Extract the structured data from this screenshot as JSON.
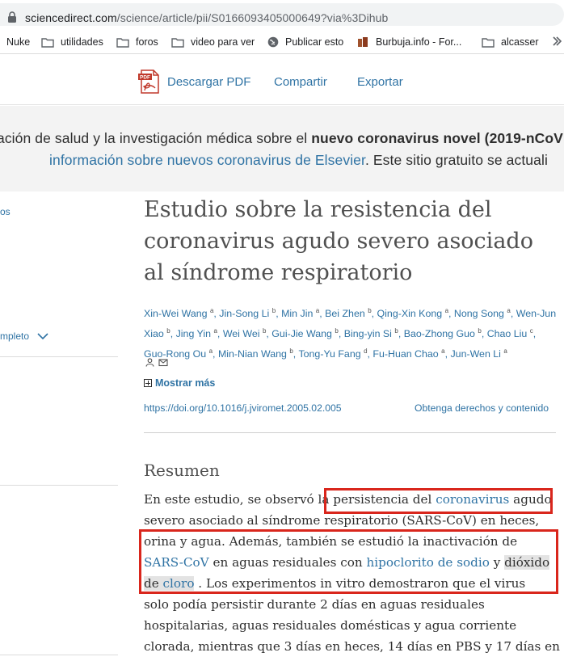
{
  "browser": {
    "url_host": "sciencedirect.com",
    "url_path": "/science/article/pii/S0166093405000649?via%3Dihub",
    "bookmarks": [
      {
        "label": "Nuke",
        "icon": "none"
      },
      {
        "label": "utilidades",
        "icon": "folder-icon"
      },
      {
        "label": "foros",
        "icon": "folder-icon"
      },
      {
        "label": "video para ver",
        "icon": "folder-icon"
      },
      {
        "label": "Publicar esto",
        "icon": "globe-icon"
      },
      {
        "label": "Burbuja.info - For...",
        "icon": "site-icon"
      },
      {
        "label": "alcasser",
        "icon": "folder-icon"
      }
    ]
  },
  "toolbar": {
    "download_pdf": "Descargar PDF",
    "share": "Compartir",
    "export": "Exportar"
  },
  "banner": {
    "line1_prefix": "ación de salud y la investigación médica sobre el ",
    "line1_bold": "nuevo coronavirus novel (2019-nCoV",
    "line2_link": "información sobre nuevos coronavirus de Elsevier",
    "line2_suffix": ". Este sitio gratuito se actuali"
  },
  "sidebar": {
    "link1": "os",
    "link2": "mpleto"
  },
  "article": {
    "title": "Estudio sobre la resistencia del coronavirus agudo severo asociado al síndrome respiratorio",
    "authors": [
      {
        "name": "Xin-Wei Wang",
        "sup": "a"
      },
      {
        "name": "Jin-Song Li",
        "sup": "b"
      },
      {
        "name": "Min Jin",
        "sup": "a"
      },
      {
        "name": "Bei Zhen",
        "sup": "b"
      },
      {
        "name": "Qing-Xin Kong",
        "sup": "a"
      },
      {
        "name": "Nong Song",
        "sup": "a"
      },
      {
        "name": "Wen-Jun Xiao",
        "sup": "b"
      },
      {
        "name": "Jing Yin",
        "sup": "a"
      },
      {
        "name": "Wei Wei",
        "sup": "b"
      },
      {
        "name": "Gui-Jie Wang",
        "sup": "b"
      },
      {
        "name": "Bing-yin Si",
        "sup": "b"
      },
      {
        "name": "Bao-Zhong Guo",
        "sup": "b"
      },
      {
        "name": "Chao Liu",
        "sup": "c"
      },
      {
        "name": "Guo-Rong Ou",
        "sup": "a"
      },
      {
        "name": "Min-Nian Wang",
        "sup": "b"
      },
      {
        "name": "Tong-Yu Fang",
        "sup": "d"
      },
      {
        "name": "Fu-Huan Chao",
        "sup": "a"
      },
      {
        "name": "Jun-Wen Li",
        "sup": "a"
      }
    ],
    "show_more": "Mostrar más",
    "doi": "https://doi.org/10.1016/j.jviromet.2005.02.005",
    "rights": "Obtenga derechos y contenido",
    "abstract_heading": "Resumen",
    "abstract": {
      "l1_a": "En este estudio, se observó la ",
      "l1_b": "persistencia del ",
      "l1_link": "coronavirus",
      "l1_c": " agudo",
      "l2": "severo asociado al síndrome respiratorio (SARS-CoV) en heces,",
      "l3": "orina y agua. Además, también se estudió la inactivación de",
      "l4_link1": "SARS-CoV",
      "l4_b": " en aguas residuales con ",
      "l4_link2": "hipoclorito de sodio",
      "l4_c": " y ",
      "l4_hl": "dióxido",
      "l5_hl": "de ",
      "l5_link": "cloro",
      "l5_b": " . Los experimentos in vitro demostraron que el virus",
      "l6": "solo podía persistir durante 2 días en aguas residuales",
      "l7": "hospitalarias, aguas residuales domésticas y agua corriente",
      "l8": "clorada, mientras que 3 días en heces, 14 días en PBS y 17 días en"
    }
  },
  "colors": {
    "link": "#2f73a4",
    "annotation_red": "#d9261c",
    "banner_bg": "#f3f3f3"
  }
}
